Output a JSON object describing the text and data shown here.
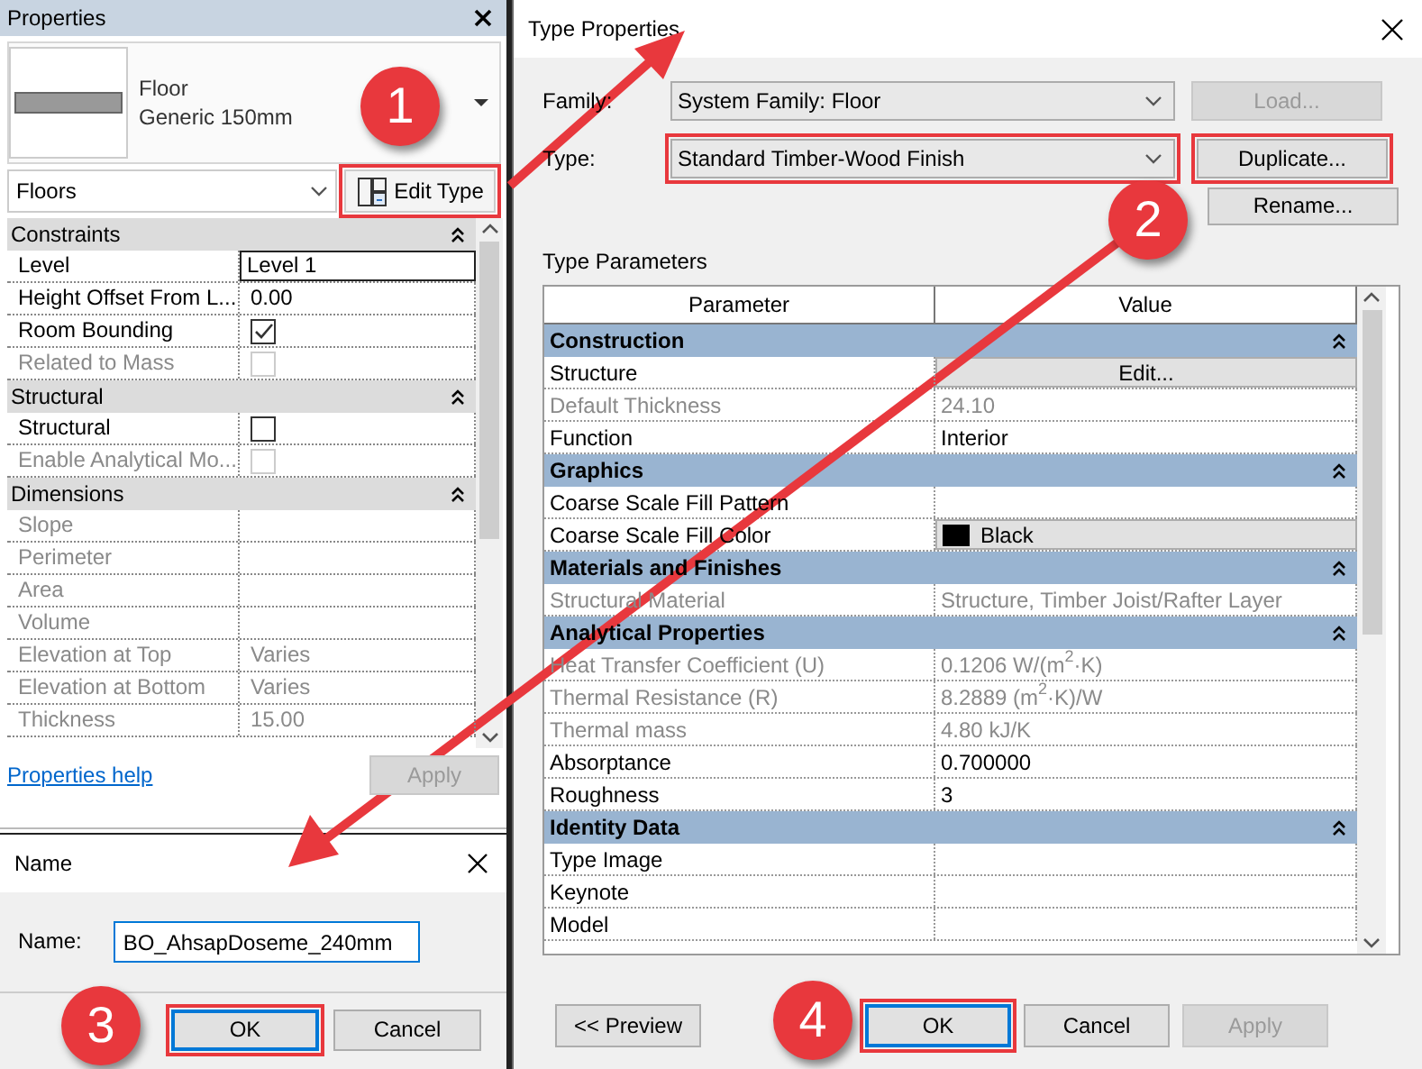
{
  "properties_panel": {
    "title": "Properties",
    "type_selector": {
      "family": "Floor",
      "type": "Generic 150mm"
    },
    "category": "Floors",
    "edit_type_button": {
      "label": "Edit Type",
      "highlighted": true,
      "callout": "1"
    },
    "sections": [
      {
        "name": "Constraints",
        "expanded": true,
        "rows": [
          {
            "label": "Level",
            "kind": "input",
            "value": "Level 1",
            "disabled": false
          },
          {
            "label": "Height Offset From L...",
            "kind": "text",
            "value": "0.00",
            "disabled": false
          },
          {
            "label": "Room Bounding",
            "kind": "checkbox",
            "checked": true,
            "disabled": false
          },
          {
            "label": "Related to Mass",
            "kind": "checkbox",
            "checked": false,
            "disabled": true
          }
        ]
      },
      {
        "name": "Structural",
        "expanded": true,
        "rows": [
          {
            "label": "Structural",
            "kind": "checkbox",
            "checked": false,
            "disabled": false
          },
          {
            "label": "Enable Analytical Mo...",
            "kind": "checkbox",
            "checked": false,
            "disabled": true
          }
        ]
      },
      {
        "name": "Dimensions",
        "expanded": true,
        "rows": [
          {
            "label": "Slope",
            "kind": "text",
            "disabled": true
          },
          {
            "label": "Perimeter",
            "kind": "text",
            "disabled": true
          },
          {
            "label": "Area",
            "kind": "text",
            "disabled": true
          },
          {
            "label": "Volume",
            "kind": "text",
            "disabled": true
          },
          {
            "label": "Elevation at Top",
            "kind": "text",
            "value": "Varies",
            "disabled": true
          },
          {
            "label": "Elevation at Bottom",
            "kind": "text",
            "value": "Varies",
            "disabled": true
          },
          {
            "label": "Thickness",
            "kind": "text",
            "value": "15.00",
            "disabled": true
          }
        ]
      }
    ],
    "help_link": "Properties help",
    "apply_button": {
      "label": "Apply",
      "disabled": true
    }
  },
  "name_dialog": {
    "title": "Name",
    "field_label": "Name:",
    "value": "BO_AhsapDoseme_240mm",
    "buttons": [
      {
        "label": "OK",
        "focused": true,
        "highlighted": true,
        "callout": "3"
      },
      {
        "label": "Cancel",
        "focused": false,
        "highlighted": false
      }
    ]
  },
  "type_properties": {
    "title": "Type Properties",
    "family": {
      "label": "Family:",
      "value": "System Family: Floor",
      "highlighted": false
    },
    "load_button": {
      "label": "Load...",
      "disabled": true
    },
    "type": {
      "label": "Type:",
      "value": "Standard Timber-Wood Finish",
      "highlighted": true
    },
    "duplicate_button": {
      "label": "Duplicate...",
      "highlighted": true,
      "callout": "2"
    },
    "rename_button": {
      "label": "Rename..."
    },
    "parameters_label": "Type Parameters",
    "columns": [
      "Parameter",
      "Value"
    ],
    "sections": [
      {
        "name": "Construction",
        "expanded": true,
        "rows": [
          {
            "label": "Structure",
            "kind": "button",
            "value": "Edit...",
            "disabled": false
          },
          {
            "label": "Default Thickness",
            "kind": "text",
            "value": "24.10",
            "disabled": true
          },
          {
            "label": "Function",
            "kind": "text",
            "value": "Interior",
            "disabled": false
          }
        ]
      },
      {
        "name": "Graphics",
        "expanded": true,
        "rows": [
          {
            "label": "Coarse Scale Fill Pattern",
            "kind": "text",
            "disabled": false
          },
          {
            "label": "Coarse Scale Fill Color",
            "kind": "color",
            "value": "Black",
            "color": "#000000",
            "disabled": false
          }
        ]
      },
      {
        "name": "Materials and Finishes",
        "expanded": true,
        "rows": [
          {
            "label": "Structural Material",
            "kind": "text",
            "value": "Structure, Timber Joist/Rafter Layer",
            "disabled": true
          }
        ]
      },
      {
        "name": "Analytical Properties",
        "expanded": true,
        "rows": [
          {
            "label": "Heat Transfer Coefficient (U)",
            "kind": "text",
            "value": "0.1206 W/(m$^{2}$·K)",
            "disabled": true
          },
          {
            "label": "Thermal Resistance (R)",
            "kind": "text",
            "value": "8.2889 (m$^{2}$·K)/W",
            "disabled": true
          },
          {
            "label": "Thermal mass",
            "kind": "text",
            "value": "4.80 kJ/K",
            "disabled": true
          },
          {
            "label": "Absorptance",
            "kind": "text",
            "value": "0.700000",
            "disabled": false
          },
          {
            "label": "Roughness",
            "kind": "text",
            "value": "3",
            "disabled": false
          }
        ]
      },
      {
        "name": "Identity Data",
        "expanded": true,
        "rows": [
          {
            "label": "Type Image",
            "kind": "text",
            "disabled": false
          },
          {
            "label": "Keynote",
            "kind": "text",
            "disabled": false
          },
          {
            "label": "Model",
            "kind": "text",
            "disabled": false
          }
        ]
      }
    ],
    "buttons": [
      {
        "label": "<< Preview",
        "disabled": false,
        "focused": false,
        "highlighted": false
      },
      {
        "label": "OK",
        "disabled": false,
        "focused": true,
        "highlighted": true,
        "callout": "4"
      },
      {
        "label": "Cancel",
        "disabled": false,
        "focused": false,
        "highlighted": false
      },
      {
        "label": "Apply",
        "disabled": true,
        "focused": false,
        "highlighted": false
      }
    ]
  }
}
